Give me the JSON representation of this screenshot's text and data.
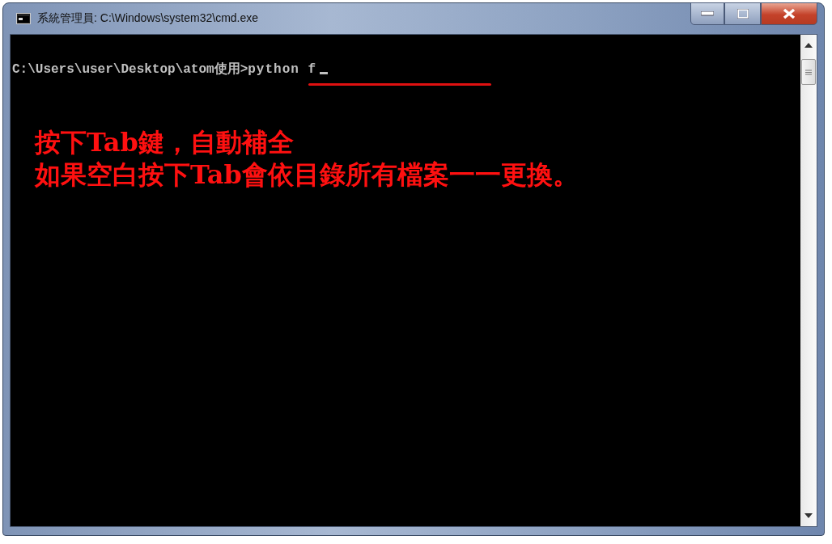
{
  "window": {
    "title": "系統管理員: C:\\Windows\\system32\\cmd.exe"
  },
  "console": {
    "prompt": "C:\\Users\\user\\Desktop\\atom使用>",
    "command": "python f"
  },
  "annotation": [
    "按下Tab鍵，自動補全",
    "如果空白按下Tab會依目錄所有檔案一一更換。"
  ]
}
